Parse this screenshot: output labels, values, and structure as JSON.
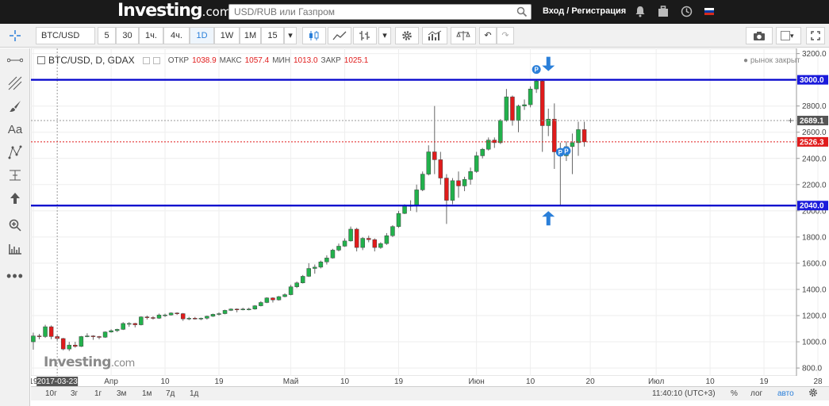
{
  "header": {
    "logo": "Investing",
    "logo_suffix": ".com",
    "search_placeholder": "USD/RUB или Газпром",
    "login_label": "Вход / Регистрация",
    "icons": [
      "bell-icon",
      "briefcase-icon",
      "clock-icon",
      "russia-flag-icon"
    ]
  },
  "toolbar": {
    "symbol": "BTC/USD",
    "intervals": [
      "5",
      "30",
      "1ч.",
      "4ч.",
      "1D",
      "1W",
      "1M",
      "15"
    ],
    "selected_interval": "1D"
  },
  "legend": {
    "title": "BTC/USD, D, GDAX",
    "open_label": "ОТКР",
    "open": "1038.9",
    "high_label": "МАКС",
    "high": "1057.4",
    "low_label": "МИН",
    "low": "1013.0",
    "close_label": "ЗАКР",
    "close": "1025.1",
    "status": "рынок закрыт"
  },
  "watermark": {
    "text": "Investing",
    "suffix": ".com"
  },
  "crosshair_date": "2017-03-23",
  "price_labels": {
    "upper_line": "3000.0",
    "crosshair": "2689.1",
    "last": "2526.3",
    "lower_line": "2040.0"
  },
  "bottombar": {
    "ranges": [
      "10г",
      "3г",
      "1г",
      "3м",
      "1м",
      "7д",
      "1д"
    ],
    "time": "11:40:10 (UTC+3)",
    "percent": "%",
    "log": "лог",
    "auto": "авто"
  },
  "colors": {
    "up": "#22b14c",
    "down": "#e01b1b",
    "line": "#0000cc",
    "arrow": "#2a7fd9",
    "last": "#e01b1b"
  },
  "chart_data": {
    "type": "candlestick",
    "title": "BTC/USD, D, GDAX",
    "ylim": [
      740,
      3240
    ],
    "yticks": [
      800,
      1000,
      1200,
      1400,
      1600,
      1800,
      2000,
      2200,
      2400,
      2600,
      2800,
      3000,
      3200
    ],
    "xticks": [
      {
        "label": "19",
        "date": "2017-03-19"
      },
      {
        "label": "Апр",
        "date": "2017-04-01"
      },
      {
        "label": "10",
        "date": "2017-04-10"
      },
      {
        "label": "19",
        "date": "2017-04-19"
      },
      {
        "label": "Май",
        "date": "2017-05-01"
      },
      {
        "label": "10",
        "date": "2017-05-10"
      },
      {
        "label": "19",
        "date": "2017-05-19"
      },
      {
        "label": "Июн",
        "date": "2017-06-01"
      },
      {
        "label": "10",
        "date": "2017-06-10"
      },
      {
        "label": "20",
        "date": "2017-06-20"
      },
      {
        "label": "Июл",
        "date": "2017-07-01"
      },
      {
        "label": "10",
        "date": "2017-07-10"
      },
      {
        "label": "19",
        "date": "2017-07-19"
      },
      {
        "label": "28",
        "date": "2017-07-28"
      }
    ],
    "horizontal_lines": [
      3000,
      2040
    ],
    "last_price": 2526.3,
    "crosshair_price": 2689.1,
    "candles": [
      {
        "date": "2017-03-19",
        "open": 1000,
        "high": 1070,
        "low": 940,
        "close": 1045
      },
      {
        "date": "2017-03-20",
        "open": 1045,
        "high": 1060,
        "low": 1020,
        "close": 1040
      },
      {
        "date": "2017-03-21",
        "open": 1040,
        "high": 1130,
        "low": 1030,
        "close": 1115
      },
      {
        "date": "2017-03-22",
        "open": 1115,
        "high": 1125,
        "low": 1020,
        "close": 1040
      },
      {
        "date": "2017-03-23",
        "open": 1040,
        "high": 1055,
        "low": 1010,
        "close": 1025
      },
      {
        "date": "2017-03-24",
        "open": 1025,
        "high": 1030,
        "low": 935,
        "close": 945
      },
      {
        "date": "2017-03-25",
        "open": 945,
        "high": 1000,
        "low": 930,
        "close": 975
      },
      {
        "date": "2017-03-26",
        "open": 975,
        "high": 1000,
        "low": 955,
        "close": 965
      },
      {
        "date": "2017-03-27",
        "open": 965,
        "high": 1045,
        "low": 960,
        "close": 1040
      },
      {
        "date": "2017-03-28",
        "open": 1040,
        "high": 1065,
        "low": 1035,
        "close": 1045
      },
      {
        "date": "2017-03-29",
        "open": 1045,
        "high": 1050,
        "low": 1015,
        "close": 1040
      },
      {
        "date": "2017-03-30",
        "open": 1040,
        "high": 1045,
        "low": 1020,
        "close": 1035
      },
      {
        "date": "2017-03-31",
        "open": 1035,
        "high": 1080,
        "low": 1030,
        "close": 1075
      },
      {
        "date": "2017-04-01",
        "open": 1075,
        "high": 1095,
        "low": 1070,
        "close": 1085
      },
      {
        "date": "2017-04-02",
        "open": 1085,
        "high": 1100,
        "low": 1075,
        "close": 1095
      },
      {
        "date": "2017-04-03",
        "open": 1095,
        "high": 1150,
        "low": 1090,
        "close": 1140
      },
      {
        "date": "2017-04-04",
        "open": 1140,
        "high": 1150,
        "low": 1115,
        "close": 1140
      },
      {
        "date": "2017-04-05",
        "open": 1140,
        "high": 1145,
        "low": 1110,
        "close": 1130
      },
      {
        "date": "2017-04-06",
        "open": 1130,
        "high": 1195,
        "low": 1125,
        "close": 1190
      },
      {
        "date": "2017-04-07",
        "open": 1190,
        "high": 1200,
        "low": 1170,
        "close": 1185
      },
      {
        "date": "2017-04-08",
        "open": 1185,
        "high": 1195,
        "low": 1170,
        "close": 1180
      },
      {
        "date": "2017-04-09",
        "open": 1180,
        "high": 1215,
        "low": 1175,
        "close": 1205
      },
      {
        "date": "2017-04-10",
        "open": 1205,
        "high": 1215,
        "low": 1190,
        "close": 1205
      },
      {
        "date": "2017-04-11",
        "open": 1205,
        "high": 1225,
        "low": 1200,
        "close": 1220
      },
      {
        "date": "2017-04-12",
        "open": 1220,
        "high": 1225,
        "low": 1205,
        "close": 1215
      },
      {
        "date": "2017-04-13",
        "open": 1215,
        "high": 1220,
        "low": 1160,
        "close": 1175
      },
      {
        "date": "2017-04-14",
        "open": 1175,
        "high": 1190,
        "low": 1165,
        "close": 1180
      },
      {
        "date": "2017-04-15",
        "open": 1180,
        "high": 1190,
        "low": 1170,
        "close": 1175
      },
      {
        "date": "2017-04-16",
        "open": 1175,
        "high": 1185,
        "low": 1165,
        "close": 1180
      },
      {
        "date": "2017-04-17",
        "open": 1180,
        "high": 1200,
        "low": 1170,
        "close": 1195
      },
      {
        "date": "2017-04-18",
        "open": 1195,
        "high": 1215,
        "low": 1190,
        "close": 1210
      },
      {
        "date": "2017-04-19",
        "open": 1210,
        "high": 1225,
        "low": 1200,
        "close": 1215
      },
      {
        "date": "2017-04-20",
        "open": 1215,
        "high": 1245,
        "low": 1210,
        "close": 1240
      },
      {
        "date": "2017-04-21",
        "open": 1240,
        "high": 1255,
        "low": 1235,
        "close": 1250
      },
      {
        "date": "2017-04-22",
        "open": 1250,
        "high": 1255,
        "low": 1225,
        "close": 1245
      },
      {
        "date": "2017-04-23",
        "open": 1245,
        "high": 1260,
        "low": 1240,
        "close": 1250
      },
      {
        "date": "2017-04-24",
        "open": 1250,
        "high": 1260,
        "low": 1240,
        "close": 1250
      },
      {
        "date": "2017-04-25",
        "open": 1250,
        "high": 1280,
        "low": 1245,
        "close": 1275
      },
      {
        "date": "2017-04-26",
        "open": 1275,
        "high": 1310,
        "low": 1270,
        "close": 1300
      },
      {
        "date": "2017-04-27",
        "open": 1300,
        "high": 1340,
        "low": 1295,
        "close": 1335
      },
      {
        "date": "2017-04-28",
        "open": 1335,
        "high": 1340,
        "low": 1300,
        "close": 1320
      },
      {
        "date": "2017-04-29",
        "open": 1320,
        "high": 1350,
        "low": 1315,
        "close": 1345
      },
      {
        "date": "2017-04-30",
        "open": 1345,
        "high": 1370,
        "low": 1340,
        "close": 1360
      },
      {
        "date": "2017-05-01",
        "open": 1360,
        "high": 1435,
        "low": 1355,
        "close": 1420
      },
      {
        "date": "2017-05-02",
        "open": 1420,
        "high": 1460,
        "low": 1410,
        "close": 1450
      },
      {
        "date": "2017-05-03",
        "open": 1450,
        "high": 1510,
        "low": 1445,
        "close": 1500
      },
      {
        "date": "2017-05-04",
        "open": 1500,
        "high": 1600,
        "low": 1495,
        "close": 1560
      },
      {
        "date": "2017-05-05",
        "open": 1560,
        "high": 1590,
        "low": 1520,
        "close": 1570
      },
      {
        "date": "2017-05-06",
        "open": 1570,
        "high": 1620,
        "low": 1560,
        "close": 1610
      },
      {
        "date": "2017-05-07",
        "open": 1610,
        "high": 1660,
        "low": 1590,
        "close": 1640
      },
      {
        "date": "2017-05-08",
        "open": 1640,
        "high": 1710,
        "low": 1635,
        "close": 1700
      },
      {
        "date": "2017-05-09",
        "open": 1700,
        "high": 1750,
        "low": 1690,
        "close": 1730
      },
      {
        "date": "2017-05-10",
        "open": 1730,
        "high": 1790,
        "low": 1725,
        "close": 1770
      },
      {
        "date": "2017-05-11",
        "open": 1770,
        "high": 1880,
        "low": 1765,
        "close": 1860
      },
      {
        "date": "2017-05-12",
        "open": 1860,
        "high": 1870,
        "low": 1690,
        "close": 1720
      },
      {
        "date": "2017-05-13",
        "open": 1720,
        "high": 1800,
        "low": 1700,
        "close": 1790
      },
      {
        "date": "2017-05-14",
        "open": 1790,
        "high": 1810,
        "low": 1760,
        "close": 1780
      },
      {
        "date": "2017-05-15",
        "open": 1780,
        "high": 1790,
        "low": 1690,
        "close": 1720
      },
      {
        "date": "2017-05-16",
        "open": 1720,
        "high": 1760,
        "low": 1710,
        "close": 1750
      },
      {
        "date": "2017-05-17",
        "open": 1750,
        "high": 1830,
        "low": 1740,
        "close": 1810
      },
      {
        "date": "2017-05-18",
        "open": 1810,
        "high": 1890,
        "low": 1800,
        "close": 1880
      },
      {
        "date": "2017-05-19",
        "open": 1880,
        "high": 2000,
        "low": 1870,
        "close": 1980
      },
      {
        "date": "2017-05-20",
        "open": 1980,
        "high": 2050,
        "low": 1975,
        "close": 2040
      },
      {
        "date": "2017-05-21",
        "open": 2040,
        "high": 2080,
        "low": 2000,
        "close": 2040
      },
      {
        "date": "2017-05-22",
        "open": 2040,
        "high": 2200,
        "low": 1990,
        "close": 2160
      },
      {
        "date": "2017-05-23",
        "open": 2160,
        "high": 2300,
        "low": 2150,
        "close": 2280
      },
      {
        "date": "2017-05-24",
        "open": 2280,
        "high": 2500,
        "low": 2270,
        "close": 2450
      },
      {
        "date": "2017-05-25",
        "open": 2450,
        "high": 2800,
        "low": 2280,
        "close": 2390
      },
      {
        "date": "2017-05-26",
        "open": 2390,
        "high": 2450,
        "low": 2200,
        "close": 2250
      },
      {
        "date": "2017-05-27",
        "open": 2250,
        "high": 2280,
        "low": 1900,
        "close": 2080
      },
      {
        "date": "2017-05-28",
        "open": 2080,
        "high": 2250,
        "low": 2050,
        "close": 2230
      },
      {
        "date": "2017-05-29",
        "open": 2230,
        "high": 2300,
        "low": 2100,
        "close": 2190
      },
      {
        "date": "2017-05-30",
        "open": 2190,
        "high": 2260,
        "low": 2150,
        "close": 2240
      },
      {
        "date": "2017-05-31",
        "open": 2240,
        "high": 2330,
        "low": 2200,
        "close": 2300
      },
      {
        "date": "2017-06-01",
        "open": 2300,
        "high": 2450,
        "low": 2290,
        "close": 2420
      },
      {
        "date": "2017-06-02",
        "open": 2420,
        "high": 2480,
        "low": 2400,
        "close": 2470
      },
      {
        "date": "2017-06-03",
        "open": 2470,
        "high": 2560,
        "low": 2460,
        "close": 2540
      },
      {
        "date": "2017-06-04",
        "open": 2540,
        "high": 2560,
        "low": 2480,
        "close": 2520
      },
      {
        "date": "2017-06-05",
        "open": 2520,
        "high": 2700,
        "low": 2510,
        "close": 2690
      },
      {
        "date": "2017-06-06",
        "open": 2690,
        "high": 2930,
        "low": 2680,
        "close": 2870
      },
      {
        "date": "2017-06-07",
        "open": 2870,
        "high": 2880,
        "low": 2650,
        "close": 2690
      },
      {
        "date": "2017-06-08",
        "open": 2690,
        "high": 2810,
        "low": 2600,
        "close": 2800
      },
      {
        "date": "2017-06-09",
        "open": 2800,
        "high": 2850,
        "low": 2770,
        "close": 2810
      },
      {
        "date": "2017-06-10",
        "open": 2810,
        "high": 2950,
        "low": 2790,
        "close": 2930
      },
      {
        "date": "2017-06-11",
        "open": 2930,
        "high": 3000,
        "low": 2900,
        "close": 2990
      },
      {
        "date": "2017-06-12",
        "open": 2990,
        "high": 3000,
        "low": 2450,
        "close": 2650
      },
      {
        "date": "2017-06-13",
        "open": 2650,
        "high": 2780,
        "low": 2570,
        "close": 2700
      },
      {
        "date": "2017-06-14",
        "open": 2700,
        "high": 2820,
        "low": 2320,
        "close": 2450
      },
      {
        "date": "2017-06-15",
        "open": 2450,
        "high": 2520,
        "low": 2040,
        "close": 2420
      },
      {
        "date": "2017-06-16",
        "open": 2420,
        "high": 2530,
        "low": 2380,
        "close": 2490
      },
      {
        "date": "2017-06-17",
        "open": 2490,
        "high": 2590,
        "low": 2280,
        "close": 2520
      },
      {
        "date": "2017-06-18",
        "open": 2520,
        "high": 2680,
        "low": 2420,
        "close": 2620
      },
      {
        "date": "2017-06-19",
        "open": 2620,
        "high": 2680,
        "low": 2490,
        "close": 2526.3
      }
    ],
    "markers": [
      {
        "date": "2017-06-11",
        "label": "P",
        "color": "#2a7fd9"
      },
      {
        "date": "2017-06-15",
        "label": "P",
        "color": "#2a7fd9"
      },
      {
        "date": "2017-06-16",
        "label": "P",
        "color": "#2a7fd9"
      }
    ],
    "arrows": [
      {
        "date": "2017-06-13",
        "price": 3000,
        "direction": "down",
        "color": "#2a7fd9"
      },
      {
        "date": "2017-06-13",
        "price": 2040,
        "direction": "up",
        "color": "#2a7fd9"
      }
    ]
  }
}
